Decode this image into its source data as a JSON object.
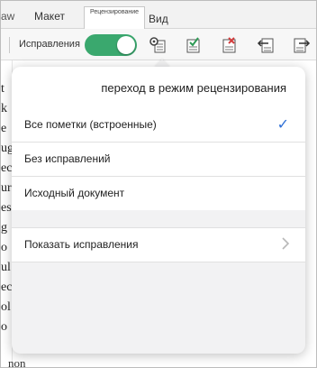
{
  "tabs": {
    "draw": "aw",
    "layout": "Макет",
    "review": "Рецензирование",
    "view": "Вид"
  },
  "toolbar": {
    "track_changes_label": "Исправления",
    "toggle_on": true,
    "accent_color": "#3aa86e"
  },
  "popover": {
    "title": "переход в режим рецензирования",
    "options": [
      {
        "label": "Все пометки (встроенные)",
        "selected": true
      },
      {
        "label": "Без исправлений",
        "selected": false
      },
      {
        "label": "Исходный документ",
        "selected": false
      }
    ],
    "check_glyph": "✓",
    "show_markup_label": "Показать исправления"
  },
  "document": {
    "fragments": [
      "t",
      "k",
      "e",
      "ug",
      "ec",
      "ur",
      "es",
      "g",
      "o",
      "ul",
      "ec",
      "ol",
      "o"
    ],
    "footer_fragment": "non"
  },
  "colors": {
    "checkmark": "#2d6fd6",
    "popover_bg": "#f2f2f3"
  }
}
